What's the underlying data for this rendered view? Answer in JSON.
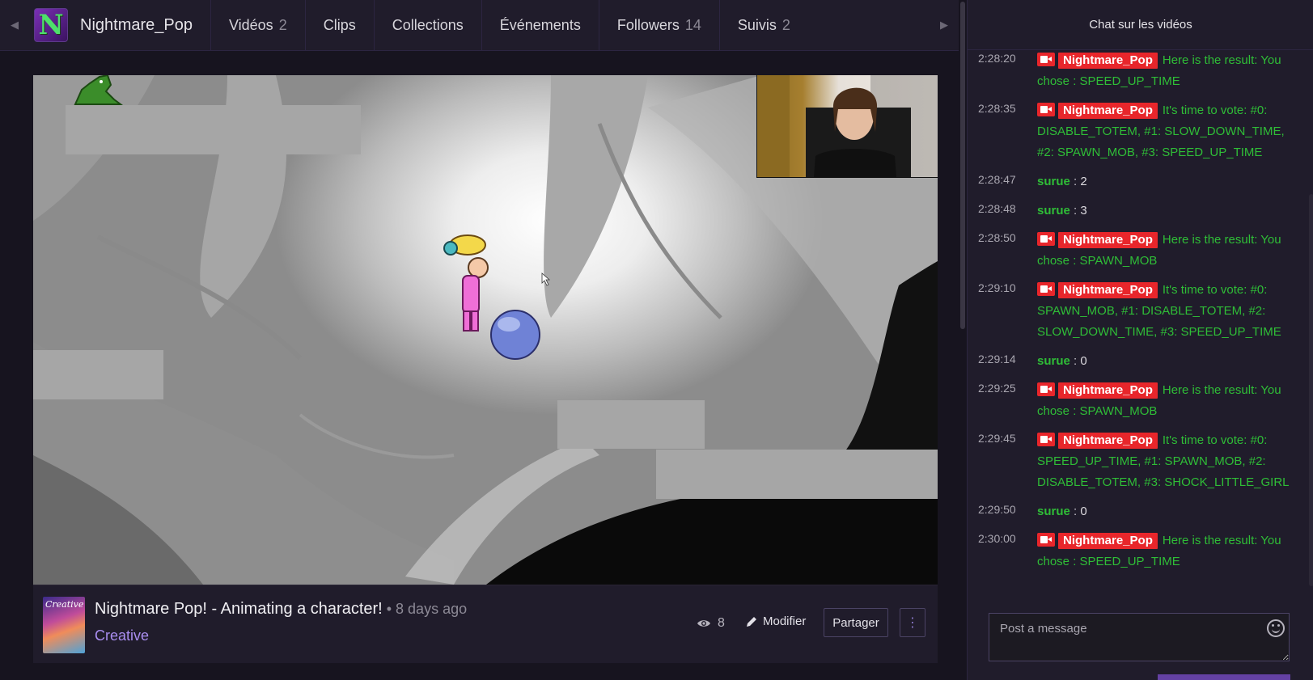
{
  "channel": {
    "name": "Nightmare_Pop",
    "avatar_letter": "N"
  },
  "nav": {
    "tabs": [
      {
        "label": "Vidéos",
        "count": "2"
      },
      {
        "label": "Clips",
        "count": ""
      },
      {
        "label": "Collections",
        "count": ""
      },
      {
        "label": "Événements",
        "count": ""
      },
      {
        "label": "Followers",
        "count": "14"
      },
      {
        "label": "Suivis",
        "count": "2"
      }
    ],
    "left_arrow": "◀",
    "right_arrow": "▶"
  },
  "video": {
    "title": "Nightmare Pop! - Animating a character!",
    "age": " • 8 days ago",
    "game": "Creative",
    "game_thumb_text": "Creative",
    "views": "8",
    "edit_label": "Modifier",
    "share_label": "Partager",
    "more_label": "⋮"
  },
  "chat": {
    "header": "Chat sur les vidéos",
    "input_placeholder": "Post a message",
    "messages": [
      {
        "time": "2:28:20",
        "user": "Nightmare_Pop",
        "broadcaster": true,
        "text": "Here is the result: You chose : SPEED_UP_TIME"
      },
      {
        "time": "2:28:35",
        "user": "Nightmare_Pop",
        "broadcaster": true,
        "text": "It's time to vote: #0: DISABLE_TOTEM, #1: SLOW_DOWN_TIME, #2: SPAWN_MOB, #3: SPEED_UP_TIME"
      },
      {
        "time": "2:28:47",
        "user": "surue",
        "broadcaster": false,
        "text": "2"
      },
      {
        "time": "2:28:48",
        "user": "surue",
        "broadcaster": false,
        "text": "3"
      },
      {
        "time": "2:28:50",
        "user": "Nightmare_Pop",
        "broadcaster": true,
        "text": "Here is the result: You chose : SPAWN_MOB"
      },
      {
        "time": "2:29:10",
        "user": "Nightmare_Pop",
        "broadcaster": true,
        "text": "It's time to vote: #0: SPAWN_MOB, #1: DISABLE_TOTEM, #2: SLOW_DOWN_TIME, #3: SPEED_UP_TIME"
      },
      {
        "time": "2:29:14",
        "user": "surue",
        "broadcaster": false,
        "text": "0"
      },
      {
        "time": "2:29:25",
        "user": "Nightmare_Pop",
        "broadcaster": true,
        "text": "Here is the result: You chose : SPAWN_MOB"
      },
      {
        "time": "2:29:45",
        "user": "Nightmare_Pop",
        "broadcaster": true,
        "text": "It's time to vote: #0: SPEED_UP_TIME, #1: SPAWN_MOB, #2: DISABLE_TOTEM, #3: SHOCK_LITTLE_GIRL"
      },
      {
        "time": "2:29:50",
        "user": "surue",
        "broadcaster": false,
        "text": "0"
      },
      {
        "time": "2:30:00",
        "user": "Nightmare_Pop",
        "broadcaster": true,
        "text": "Here is the result: You chose : SPEED_UP_TIME"
      }
    ]
  },
  "colors": {
    "accent": "#6441a4",
    "broadcaster_badge": "#e8262b",
    "chat_green": "#2fbd37",
    "game_link": "#a98ef0"
  }
}
